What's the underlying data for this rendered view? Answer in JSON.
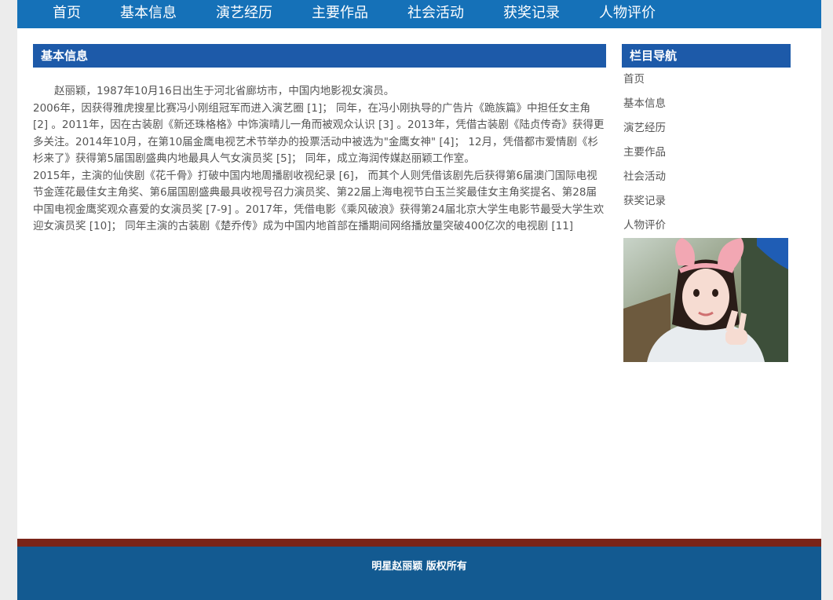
{
  "nav": {
    "items": [
      "首页",
      "基本信息",
      "演艺经历",
      "主要作品",
      "社会活动",
      "获奖记录",
      "人物评价"
    ]
  },
  "main": {
    "title": "基本信息",
    "paragraphs": [
      "赵丽颖，1987年10月16日出生于河北省廊坊市，中国内地影视女演员。",
      "2006年，因获得雅虎搜星比赛冯小刚组冠军而进入演艺圈 [1]； 同年，在冯小刚执导的广告片《跪族篇》中担任女主角 [2] 。2011年，因在古装剧《新还珠格格》中饰演晴儿一角而被观众认识 [3] 。2013年，凭借古装剧《陆贞传奇》获得更多关注。2014年10月，在第10届金鹰电视艺术节举办的投票活动中被选为\"金鹰女神\" [4]； 12月，凭借都市爱情剧《杉杉来了》获得第5届国剧盛典内地最具人气女演员奖 [5]； 同年，成立海润传媒赵丽颖工作室。",
      "2015年，主演的仙侠剧《花千骨》打破中国内地周播剧收视纪录 [6]， 而其个人则凭借该剧先后获得第6届澳门国际电视节金莲花最佳女主角奖、第6届国剧盛典最具收视号召力演员奖、第22届上海电视节白玉兰奖最佳女主角奖提名、第28届中国电视金鹰奖观众喜爱的女演员奖 [7-9] 。2017年，凭借电影《乘风破浪》获得第24届北京大学生电影节最受大学生欢迎女演员奖 [10]； 同年主演的古装剧《楚乔传》成为中国内地首部在播期间网络播放量突破400亿次的电视剧 [11]"
    ]
  },
  "sidebar": {
    "title": "栏目导航",
    "items": [
      "首页",
      "基本信息",
      "演艺经历",
      "主要作品",
      "社会活动",
      "获奖记录",
      "人物评价"
    ]
  },
  "footer": {
    "text": "明星赵丽颖 版权所有"
  },
  "colors": {
    "nav_bg": "#1571b8",
    "heading_bg": "#1d5aa9",
    "footer_accent": "#7a2418",
    "footer_bg": "#135a91"
  }
}
